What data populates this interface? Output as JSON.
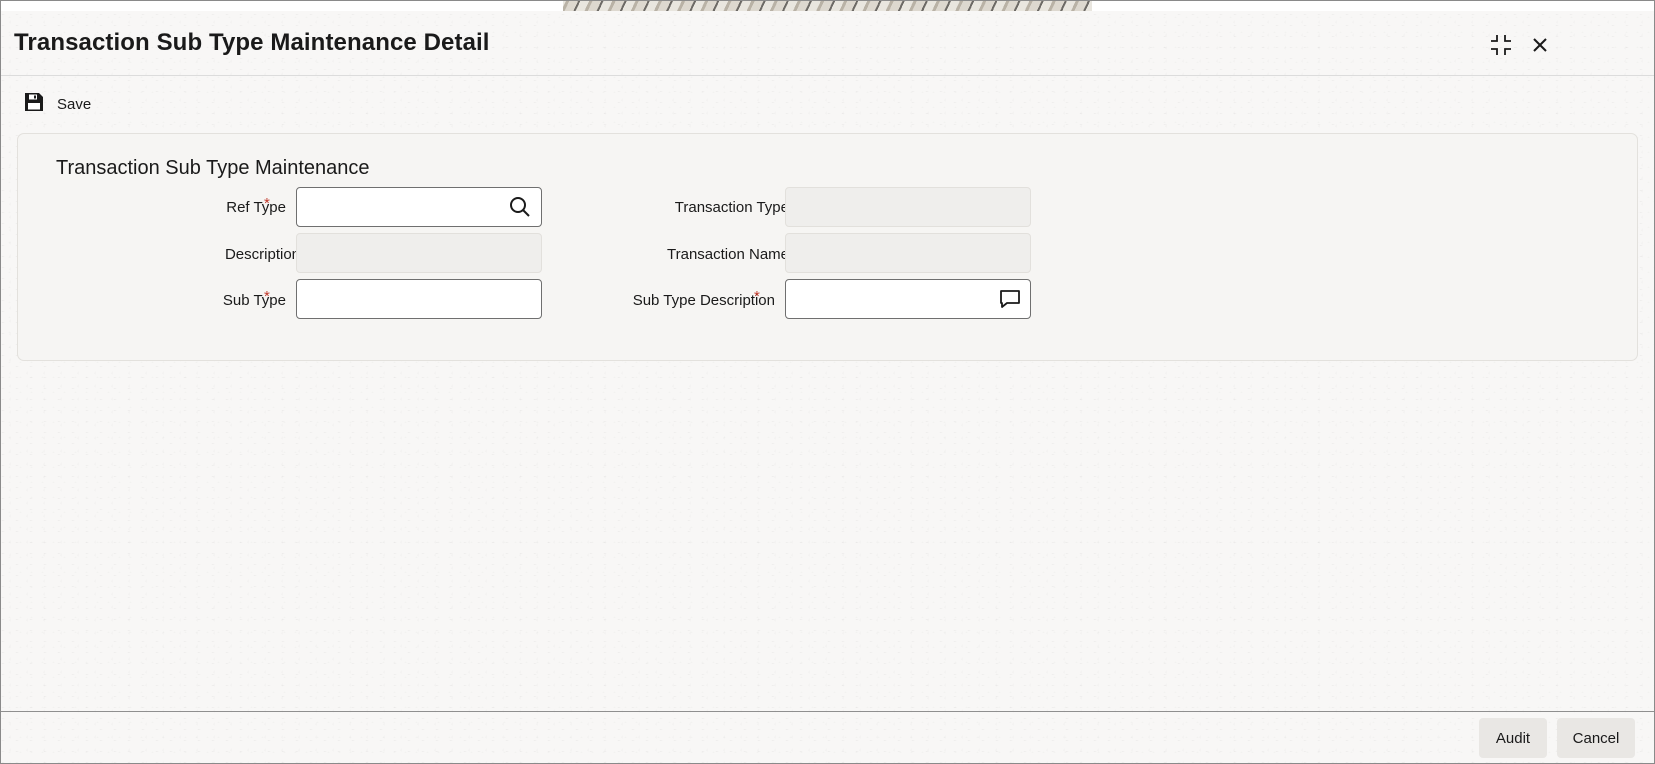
{
  "window": {
    "title": "Transaction Sub Type Maintenance Detail"
  },
  "header_icons": {
    "maximize": "maximize-icon",
    "close": "close-icon"
  },
  "toolbar": {
    "save_label": "Save",
    "save_icon": "floppy-disk-icon"
  },
  "section": {
    "title": "Transaction Sub Type Maintenance"
  },
  "fields": {
    "ref_type": {
      "label": "Ref Type",
      "required_mark": "*",
      "value": "",
      "icon": "search-icon"
    },
    "description": {
      "label": "Description",
      "value": ""
    },
    "sub_type": {
      "label": "Sub Type",
      "required_mark": "*",
      "value": ""
    },
    "transaction_type": {
      "label": "Transaction Type",
      "value": ""
    },
    "transaction_name": {
      "label": "Transaction Name",
      "value": ""
    },
    "sub_type_description": {
      "label": "Sub Type Description",
      "required_mark": "*",
      "value": "",
      "icon": "speech-bubble-icon"
    }
  },
  "footer": {
    "audit_label": "Audit",
    "cancel_label": "Cancel"
  },
  "colors": {
    "required": "#c0392b",
    "panel_bg": "#f6f5f3",
    "readonly_bg": "#efeeec",
    "button_bg": "#e9e7e4"
  }
}
